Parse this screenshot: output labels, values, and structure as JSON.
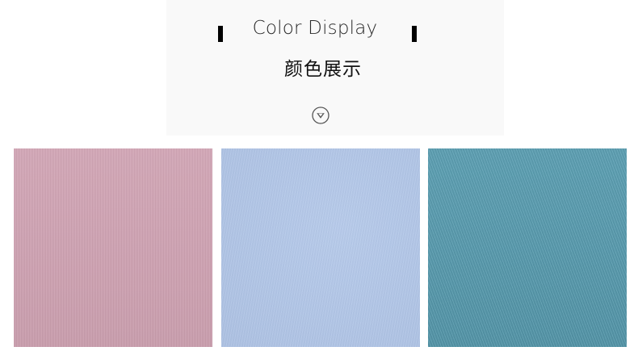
{
  "header": {
    "title_en": "Color Display",
    "title_cn": "颜色展示",
    "scroll_icon": "chevron-down-circle-icon"
  },
  "swatches": [
    {
      "color": "#d2a3b4"
    },
    {
      "color": "#b3c8ea"
    },
    {
      "color": "#5a9fb3"
    }
  ],
  "colors": {
    "header_bg": "#f9f9f9",
    "title_bar": "#000000",
    "icon": "#555555"
  }
}
